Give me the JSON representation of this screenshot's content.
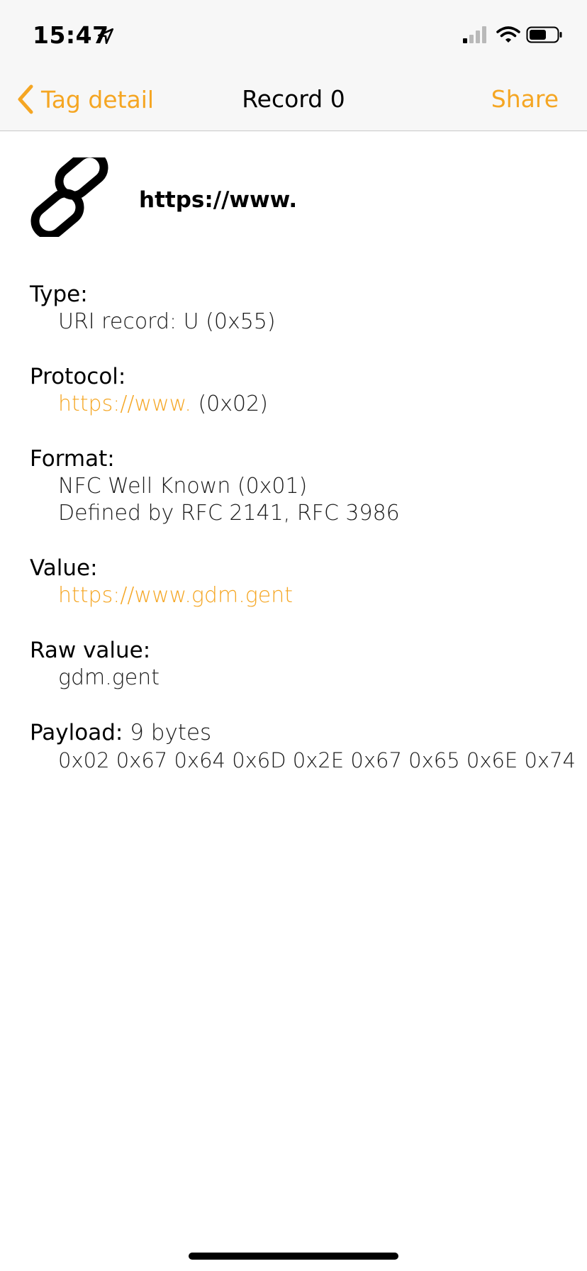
{
  "status_bar": {
    "time": "15:47",
    "icons": [
      "location-arrow-icon",
      "cellular-signal-icon",
      "wifi-icon",
      "battery-icon"
    ]
  },
  "nav": {
    "back_label": "Tag detail",
    "title": "Record 0",
    "share_label": "Share"
  },
  "header": {
    "icon": "link-icon",
    "text": "https://www."
  },
  "details": {
    "type": {
      "label": "Type:",
      "value": "URI record: U (0x55)"
    },
    "protocol": {
      "label": "Protocol:",
      "link": "https://www.",
      "code": " (0x02)"
    },
    "format": {
      "label": "Format:",
      "line1": "NFC Well Known (0x01)",
      "line2": "Defined by RFC 2141, RFC 3986"
    },
    "value": {
      "label": "Value:",
      "link": "https://www.gdm.gent"
    },
    "raw_value": {
      "label": "Raw value:",
      "value": "gdm.gent"
    },
    "payload": {
      "label": "Payload:",
      "size": " 9 bytes",
      "bytes": "0x02 0x67 0x64 0x6D 0x2E 0x67 0x65 0x6E 0x74"
    }
  },
  "colors": {
    "accent": "#f5a623",
    "bar_background": "#f7f7f7",
    "text": "#000000"
  }
}
